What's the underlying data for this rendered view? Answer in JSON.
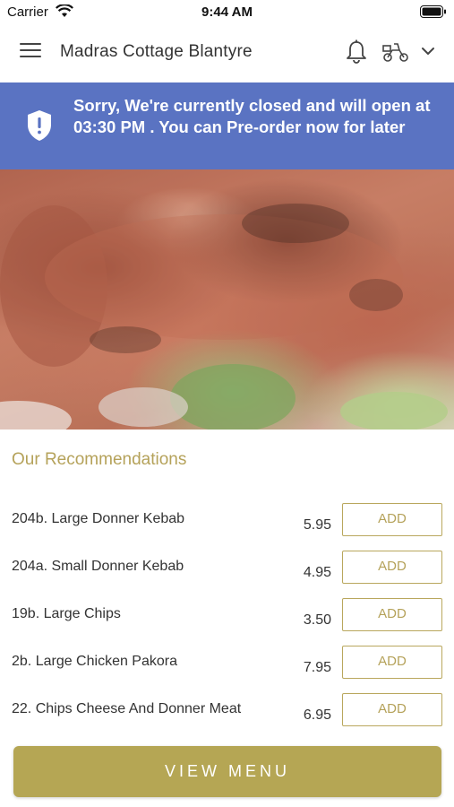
{
  "status_bar": {
    "carrier": "Carrier",
    "time": "9:44 AM"
  },
  "header": {
    "title": "Madras Cottage Blantyre",
    "icons": [
      "menu-icon",
      "bell-icon",
      "scooter-icon",
      "chevron-down-icon"
    ]
  },
  "banner": {
    "message": "Sorry, We're currently closed and will open at 03:30 PM . You can Pre-order now for later",
    "background_color": "#5a73c2",
    "icon": "shield-icon"
  },
  "recommendations": {
    "title": "Our Recommendations",
    "items": [
      {
        "name": "204b. Large Donner Kebab",
        "price": "5.95",
        "button": "ADD"
      },
      {
        "name": "204a. Small Donner Kebab",
        "price": "4.95",
        "button": "ADD"
      },
      {
        "name": "19b. Large Chips",
        "price": "3.50",
        "button": "ADD"
      },
      {
        "name": "2b. Large Chicken Pakora",
        "price": "7.95",
        "button": "ADD"
      },
      {
        "name": "22. Chips Cheese And Donner Meat",
        "price": "6.95",
        "button": "ADD"
      }
    ]
  },
  "footer": {
    "view_menu_label": "VIEW MENU",
    "accent_color": "#b5a654"
  }
}
